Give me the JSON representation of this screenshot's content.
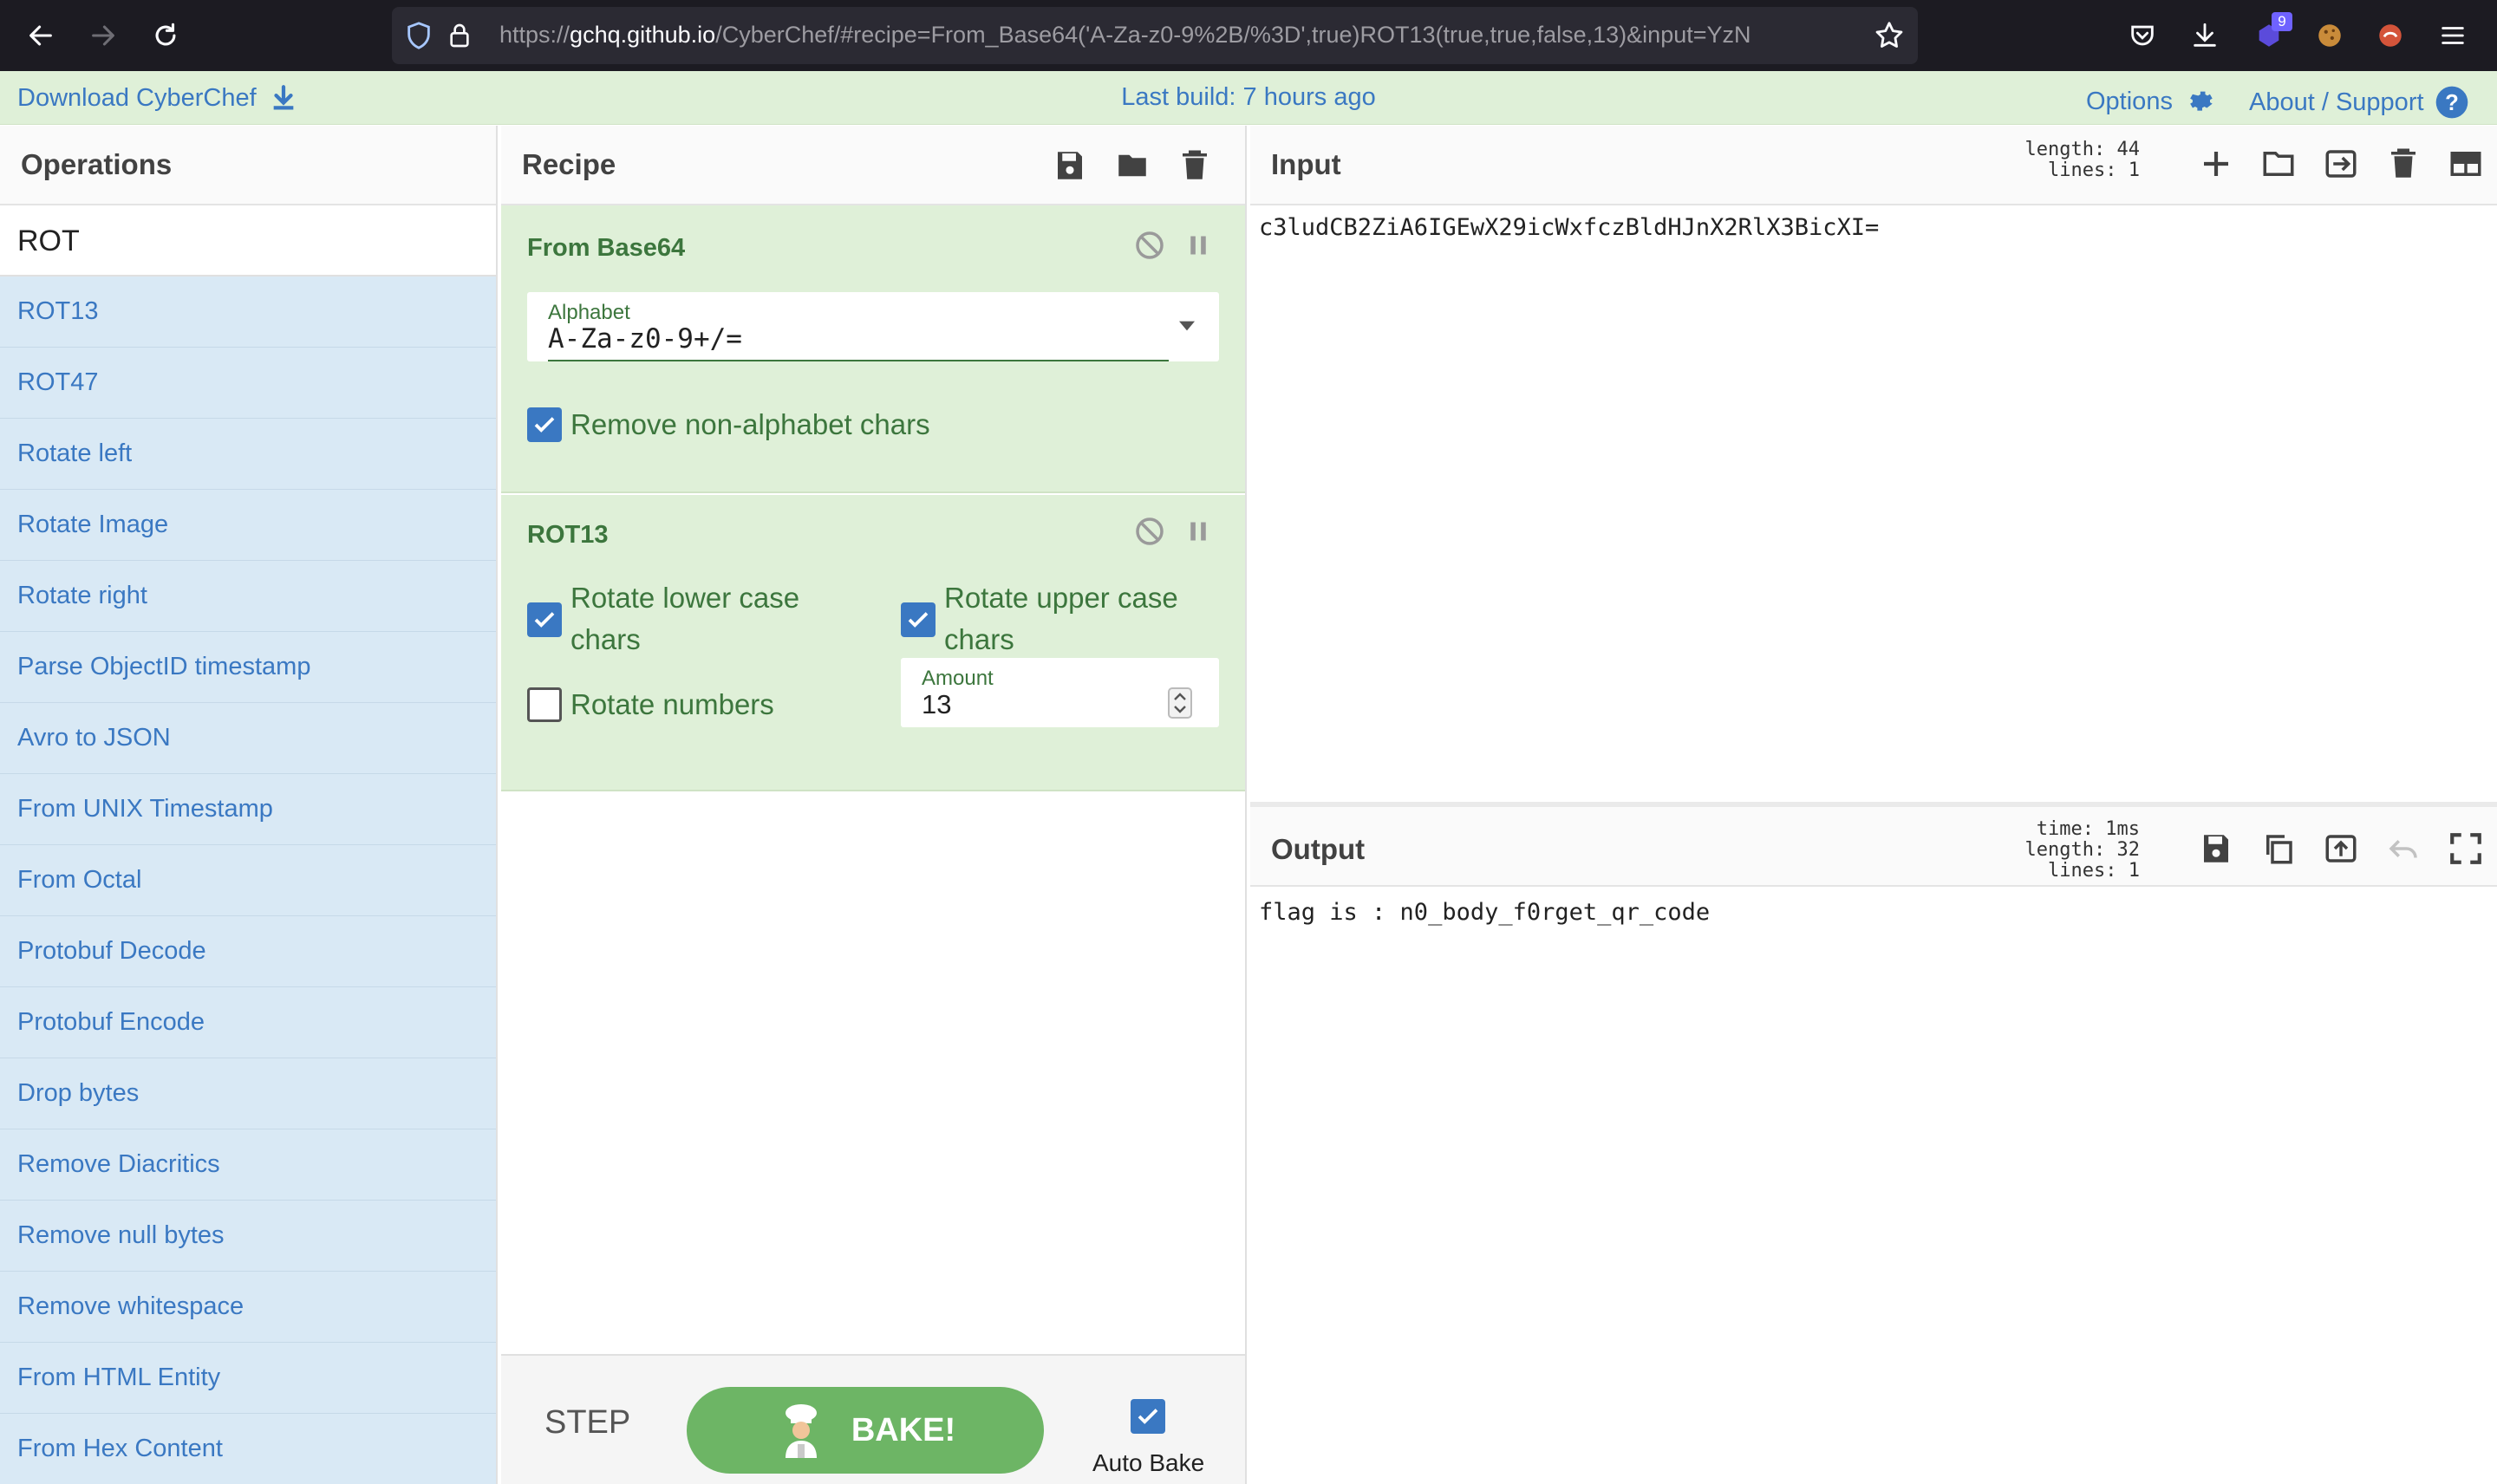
{
  "browser": {
    "url_main": "https://gchq.github.io/CyberChef/#recipe=From_Base64('A-Za-z0-9%2B/%3D',true)ROT13(true,true,false,13)&input=YzN",
    "url_host": "gchq.github.io",
    "badge_count": "9",
    "colors": {
      "bar": "#1c1b22",
      "url_field": "#2b2a33"
    }
  },
  "banner": {
    "download_label": "Download CyberChef",
    "last_build": "Last build: 7 hours ago",
    "options_label": "Options",
    "about_label": "About / Support"
  },
  "operations": {
    "title": "Operations",
    "search_value": "ROT",
    "items": [
      "ROT13",
      "ROT47",
      "Rotate left",
      "Rotate Image",
      "Rotate right",
      "Parse ObjectID timestamp",
      "Avro to JSON",
      "From UNIX Timestamp",
      "From Octal",
      "Protobuf Decode",
      "Protobuf Encode",
      "Drop bytes",
      "Remove Diacritics",
      "Remove null bytes",
      "Remove whitespace",
      "From HTML Entity",
      "From Hex Content"
    ]
  },
  "recipe": {
    "title": "Recipe",
    "from_base64": {
      "title": "From Base64",
      "alphabet_label": "Alphabet",
      "alphabet_value": "A-Za-z0-9+/=",
      "remove_nonalpha_label": "Remove non-alphabet chars",
      "remove_nonalpha_checked": true
    },
    "rot13": {
      "title": "ROT13",
      "rotate_lower_label": "Rotate lower case chars",
      "rotate_lower_checked": true,
      "rotate_upper_label": "Rotate upper case chars",
      "rotate_upper_checked": true,
      "rotate_numbers_label": "Rotate numbers",
      "rotate_numbers_checked": false,
      "amount_label": "Amount",
      "amount_value": "13"
    },
    "step_label": "STEP",
    "bake_label": "BAKE!",
    "auto_bake_label": "Auto Bake",
    "auto_bake_checked": true
  },
  "input": {
    "title": "Input",
    "stats_length": "length: 44",
    "stats_lines": "lines:  1",
    "text": "c3ludCB2ZiA6IGEwX29icWxfczBldHJnX2RlX3BicXI="
  },
  "output": {
    "title": "Output",
    "stats_time": "time:  1ms",
    "stats_length": "length:  32",
    "stats_lines": "lines:   1",
    "text": "flag is : n0_body_f0rget_qr_code"
  },
  "colors": {
    "accent_blue": "#3a78c2",
    "op_green_bg": "#dff0d8",
    "op_green_text": "#3c763d",
    "op_list_bg": "#d9e9f5",
    "bake_green": "#6db565"
  }
}
